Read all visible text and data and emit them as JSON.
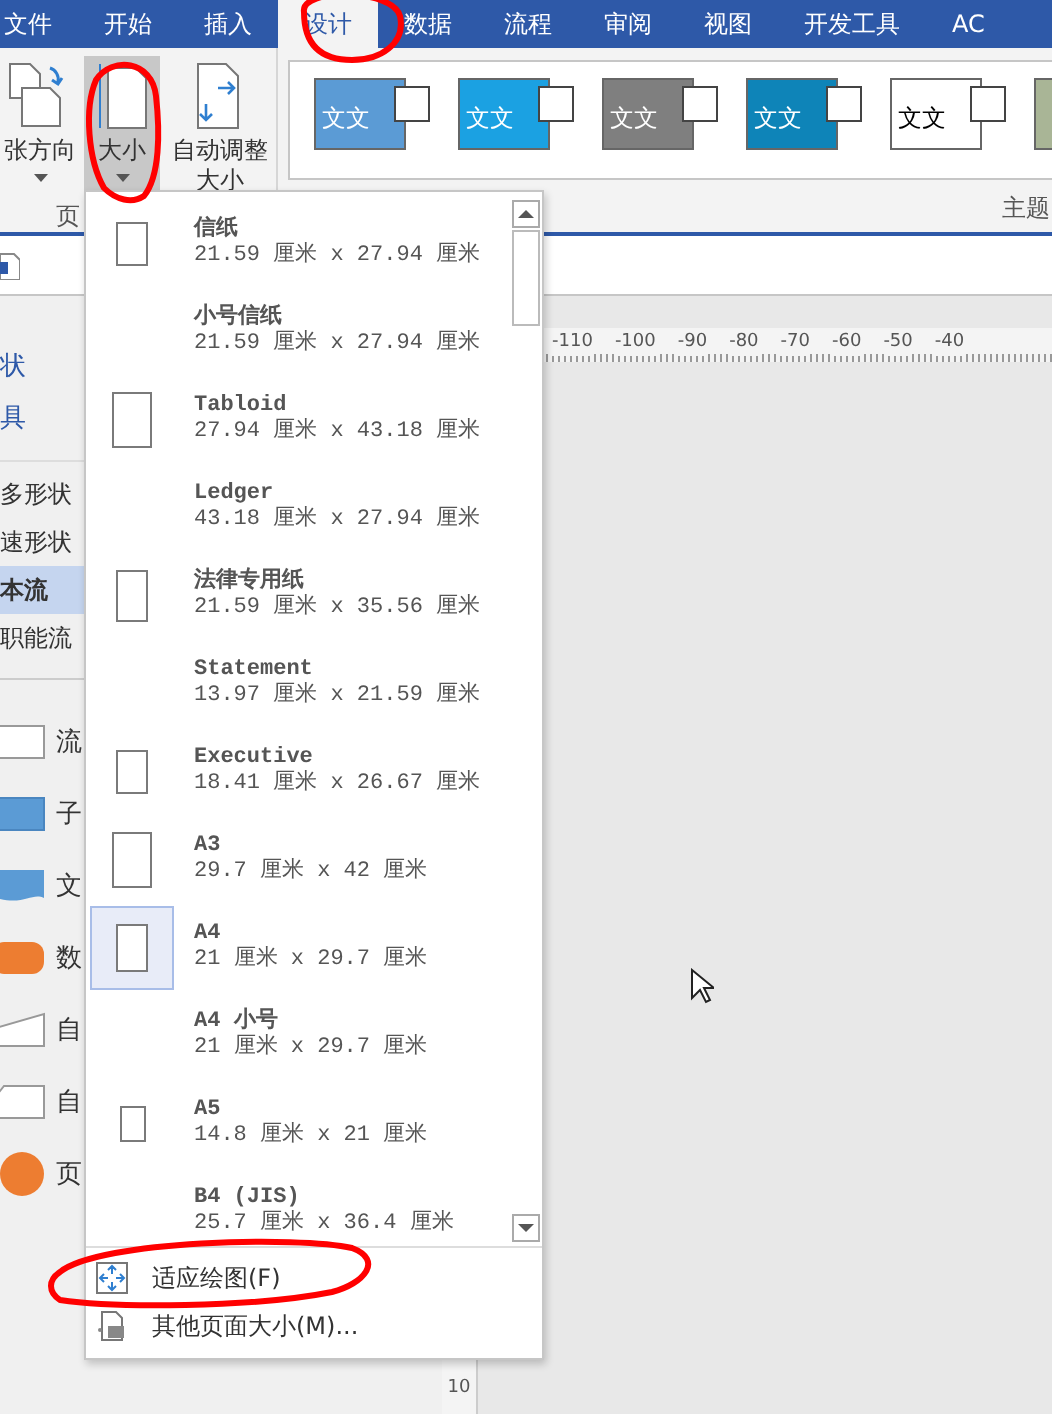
{
  "tabs": [
    {
      "label": "文件",
      "selected": false
    },
    {
      "label": "开始",
      "selected": false
    },
    {
      "label": "插入",
      "selected": false
    },
    {
      "label": "设计",
      "selected": true
    },
    {
      "label": "数据",
      "selected": false
    },
    {
      "label": "流程",
      "selected": false
    },
    {
      "label": "审阅",
      "selected": false
    },
    {
      "label": "视图",
      "selected": false
    },
    {
      "label": "开发工具",
      "selected": false
    },
    {
      "label": "AC",
      "selected": false
    }
  ],
  "ribbon": {
    "buttons": [
      {
        "kind": "orientation",
        "label": "张方向",
        "caret": true,
        "pressed": false
      },
      {
        "kind": "size",
        "label": "大小",
        "caret": true,
        "pressed": true
      },
      {
        "kind": "autosize",
        "label": "自动调整大小",
        "caret": false,
        "pressed": false
      }
    ],
    "page_group_label": "页",
    "theme_group_label": "主题",
    "themes": [
      {
        "text": "文文",
        "color": "#5b9bd5"
      },
      {
        "text": "文文",
        "color": "#1ba1e2"
      },
      {
        "text": "文文",
        "color": "#7f7f7f"
      },
      {
        "text": "文文",
        "color": "#0e84b8"
      },
      {
        "text": "文文",
        "color": "#ffffff"
      },
      {
        "color": "#a9b596"
      }
    ]
  },
  "stencil": {
    "links": [
      "状",
      "具"
    ],
    "categories": [
      {
        "label": "多形状",
        "selected": false
      },
      {
        "label": "速形状",
        "selected": false
      },
      {
        "label": "本流",
        "selected": true
      },
      {
        "label": "职能流",
        "selected": false
      }
    ],
    "shapes": [
      {
        "kind": "process",
        "label": "流"
      },
      {
        "kind": "subprocess",
        "label": "子"
      },
      {
        "kind": "document",
        "label": "文"
      },
      {
        "kind": "data",
        "label": "数"
      },
      {
        "kind": "manual-input",
        "label": "自"
      },
      {
        "kind": "manual-op",
        "label": "自"
      },
      {
        "kind": "circle",
        "label": "页"
      }
    ]
  },
  "ruler": {
    "labels": [
      "-110",
      "-100",
      "-90",
      "-80",
      "-70",
      "-60",
      "-50",
      "-40"
    ],
    "vertical_label": "10"
  },
  "dropdown": {
    "sizes": [
      {
        "name": "信纸",
        "dims": "21.59 厘米 x 27.94 厘米",
        "kind": "letter",
        "selected": false
      },
      {
        "name": "小号信纸",
        "dims": "21.59 厘米 x 27.94 厘米",
        "kind": "none",
        "selected": false
      },
      {
        "name": "Tabloid",
        "dims": "27.94 厘米 x 43.18 厘米",
        "kind": "tabloid",
        "selected": false
      },
      {
        "name": "Ledger",
        "dims": "43.18 厘米 x 27.94 厘米",
        "kind": "none",
        "selected": false
      },
      {
        "name": "法律专用纸",
        "dims": "21.59 厘米 x 35.56 厘米",
        "kind": "legal",
        "selected": false
      },
      {
        "name": "Statement",
        "dims": "13.97 厘米 x 21.59 厘米",
        "kind": "none",
        "selected": false
      },
      {
        "name": "Executive",
        "dims": "18.41 厘米 x 26.67 厘米",
        "kind": "executive",
        "selected": false
      },
      {
        "name": "A3",
        "dims": "29.7 厘米 x 42 厘米",
        "kind": "a3",
        "selected": false
      },
      {
        "name": "A4",
        "dims": "21 厘米 x 29.7 厘米",
        "kind": "a4",
        "selected": true
      },
      {
        "name": "A4 小号",
        "dims": "21 厘米 x 29.7 厘米",
        "kind": "none",
        "selected": false
      },
      {
        "name": "A5",
        "dims": "14.8 厘米 x 21 厘米",
        "kind": "a5",
        "selected": false
      },
      {
        "name": "B4 (JIS)",
        "dims": "25.7 厘米 x 36.4 厘米",
        "kind": "none",
        "selected": false
      }
    ],
    "actions": [
      {
        "kind": "fit",
        "label": "适应绘图(F)"
      },
      {
        "kind": "more",
        "label": "其他页面大小(M)..."
      }
    ]
  }
}
